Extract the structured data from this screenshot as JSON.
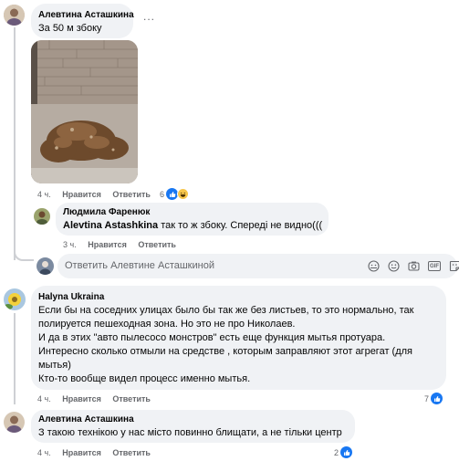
{
  "comments": [
    {
      "author": "Алевтина Асташкина",
      "text": "За 50 м збоку",
      "time": "4 ч.",
      "like_label": "Нравится",
      "reply_label": "Ответить",
      "reaction_count": "6",
      "more_label": "..."
    },
    {
      "author": "Людмила Фаренюк",
      "mention": "Alevtina Astashkina",
      "text": " так то ж збоку. Спереді не видно(((",
      "time": "3 ч.",
      "like_label": "Нравится",
      "reply_label": "Ответить"
    },
    {
      "author": "Halyna Ukraina",
      "lines": [
        "Если бы на соседних улицах было бы так же без листьев, то это нормально, так",
        "полируется пешеходная зона. Но это не про Николаев.",
        "И да в этих \"авто пылесосо монстров\" есть еще функция мытья протуара.",
        "Интересно сколько отмыли на средстве , которым заправляют этот агрегат (для",
        "мытья)",
        "Кто-то вообще видел процесс именно мытья."
      ],
      "time": "4 ч.",
      "like_label": "Нравится",
      "reply_label": "Ответить",
      "reaction_count": "7"
    },
    {
      "author": "Алевтина Асташкина",
      "text": "З такою технікою у нас місто повинно блищати, а не тільки центр",
      "time": "4 ч.",
      "like_label": "Нравится",
      "reply_label": "Ответить",
      "reaction_count": "2"
    }
  ],
  "reply_box": {
    "placeholder": "Ответить Алевтине Асташкиной",
    "gif_label": "GIF"
  },
  "colors": {
    "like_blue": "#1877f2",
    "bubble_bg": "#f0f2f5",
    "meta_gray": "#65676b"
  },
  "icons": [
    "like-icon",
    "haha-icon",
    "emoji-icon",
    "camera-icon",
    "gif-icon",
    "sticker-icon",
    "more-icon"
  ]
}
